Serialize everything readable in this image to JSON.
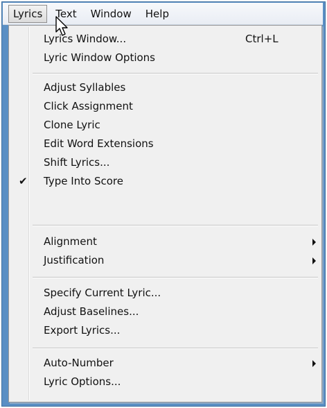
{
  "menubar": {
    "items": [
      {
        "label": "Lyrics"
      },
      {
        "label": "Text"
      },
      {
        "label": "Window"
      },
      {
        "label": "Help"
      }
    ]
  },
  "dropdown": {
    "items": [
      {
        "label": "Lyrics Window...",
        "shortcut": "Ctrl+L"
      },
      {
        "label": "Lyric Window Options"
      },
      {
        "label": "Adjust Syllables"
      },
      {
        "label": "Click Assignment"
      },
      {
        "label": "Clone Lyric"
      },
      {
        "label": "Edit Word Extensions"
      },
      {
        "label": "Shift Lyrics..."
      },
      {
        "label": "Type Into Score",
        "checked": true,
        "check_glyph": "✔"
      },
      {
        "label": "Alignment",
        "submenu": true
      },
      {
        "label": "Justification",
        "submenu": true
      },
      {
        "label": "Specify Current Lyric..."
      },
      {
        "label": "Adjust Baselines..."
      },
      {
        "label": "Export Lyrics..."
      },
      {
        "label": "Auto-Number",
        "submenu": true
      },
      {
        "label": "Lyric Options..."
      }
    ]
  },
  "colors": {
    "accent_frame": "#5a8fc4",
    "menu_background": "#f0f0f0"
  },
  "icons": {
    "cursor": "pointer-cursor-icon",
    "submenu": "submenu-arrow-icon",
    "check": "checkmark-icon"
  }
}
